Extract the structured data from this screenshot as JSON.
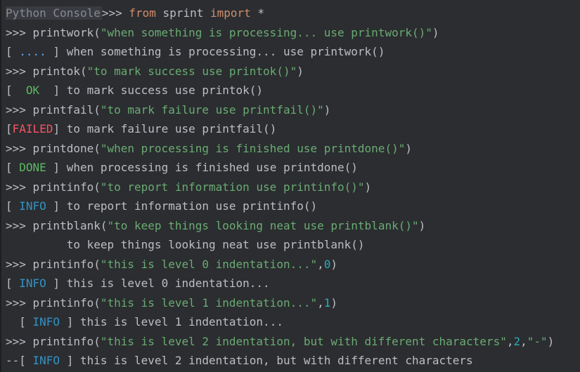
{
  "console": {
    "title": "Python Console",
    "first": {
      "prompt": ">>> ",
      "kw1": "from",
      "mid": " sprint ",
      "kw2": "import",
      "end": " *"
    },
    "lines": [
      {
        "prompt": ">>> ",
        "fn": "printwork(",
        "str": "\"when something is processing... use printwork()\"",
        "close": ")"
      },
      {
        "lb": "[ ",
        "tag": "....",
        "rb": " ] ",
        "text": "when something is processing... use printwork()"
      },
      {
        "prompt": ">>> ",
        "fn": "printok(",
        "str": "\"to mark success use printok()\"",
        "close": ")"
      },
      {
        "lb": "[  ",
        "tag": "OK",
        "rb": "  ] ",
        "text": "to mark success use printok()"
      },
      {
        "prompt": ">>> ",
        "fn": "printfail(",
        "str": "\"to mark failure use printfail()\"",
        "close": ")"
      },
      {
        "lb": "[",
        "tag": "FAILED",
        "rb": "] ",
        "text": "to mark failure use printfail()"
      },
      {
        "prompt": ">>> ",
        "fn": "printdone(",
        "str": "\"when processing is finished use printdone()\"",
        "close": ")"
      },
      {
        "lb": "[ ",
        "tag": "DONE",
        "rb": " ] ",
        "text": "when processing is finished use printdone()"
      },
      {
        "prompt": ">>> ",
        "fn": "printinfo(",
        "str": "\"to report information use printinfo()\"",
        "close": ")"
      },
      {
        "lb": "[ ",
        "tag": "INFO",
        "rb": " ] ",
        "text": "to report information use printinfo()"
      },
      {
        "prompt": ">>> ",
        "fn": "printblank(",
        "str": "\"to keep things looking neat use printblank()\"",
        "close": ")"
      },
      {
        "text": "         to keep things looking neat use printblank()"
      },
      {
        "prompt": ">>> ",
        "fn": "printinfo(",
        "str": "\"this is level 0 indentation...\"",
        "sep1": ",",
        "num1": "0",
        "close": ")"
      },
      {
        "lb": "[ ",
        "tag": "INFO",
        "rb": " ] ",
        "text": "this is level 0 indentation..."
      },
      {
        "prompt": ">>> ",
        "fn": "printinfo(",
        "str": "\"this is level 1 indentation...\"",
        "sep1": ",",
        "num1": "1",
        "close": ")"
      },
      {
        "lb": "  [ ",
        "tag": "INFO",
        "rb": " ] ",
        "text": "this is level 1 indentation..."
      },
      {
        "prompt": ">>> ",
        "fn": "printinfo(",
        "str": "\"this is level 2 indentation, but with different characters\"",
        "sep1": ",",
        "num1": "2",
        "sep2": ",",
        "str2": "\"-\"",
        "close": ")"
      },
      {
        "lb": "--[ ",
        "tag": "INFO",
        "rb": " ] ",
        "text": "this is level 2 indentation, but with different characters"
      }
    ]
  }
}
